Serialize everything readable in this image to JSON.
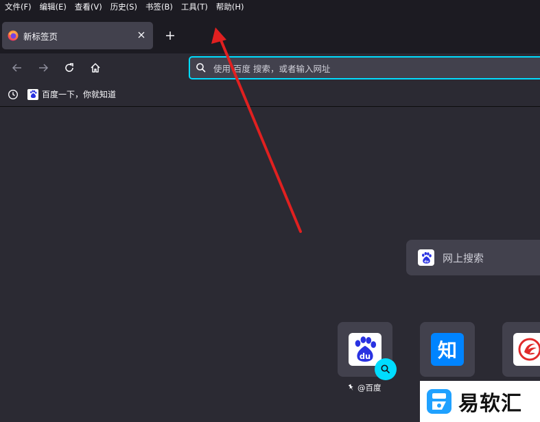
{
  "menubar": {
    "items": [
      "文件(F)",
      "编辑(E)",
      "查看(V)",
      "历史(S)",
      "书签(B)",
      "工具(T)",
      "帮助(H)"
    ]
  },
  "tab": {
    "title": "新标签页",
    "icon": "firefox-icon"
  },
  "urlbar": {
    "placeholder": "使用 百度 搜索，或者输入网址"
  },
  "bookmarks": {
    "items": [
      {
        "label": "百度一下，你就知道",
        "icon": "baidu-icon"
      }
    ]
  },
  "newtab": {
    "search_placeholder": "网上搜索",
    "shortcuts": [
      {
        "label": "@百度",
        "icon": "baidu-icon",
        "pinned": true
      },
      {
        "label": "",
        "icon": "zhihu-icon"
      },
      {
        "label": "",
        "icon": "ifeng-icon"
      }
    ],
    "zhihu_glyph": "知"
  },
  "watermark": {
    "text": "易软汇"
  },
  "colors": {
    "accent": "#00ddff",
    "annotation_arrow": "#e02020",
    "baidu_blue": "#2932e1",
    "zhihu_blue": "#0084ff"
  }
}
